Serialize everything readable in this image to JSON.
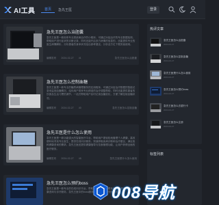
{
  "header": {
    "logo_text": "AI工具",
    "nav": [
      "首页",
      "急先王医"
    ],
    "login": "登录"
  },
  "posts": [
    {
      "title": "急先王医怎么治胆囊",
      "desc": "急先王医是一款用来专业类疾病治疗的小程序，可通过对症治疗的专业数据检测，帮助用户进行症状的诊断记录，同时还能开启多方病情的信息的，还能提供专业的医生病情解析，分析患者的身体状况给出参考建议，分析全方位下载安装使用。",
      "author": "编辑发布",
      "date": "2024-02-27",
      "views": "41",
      "category": "急先王医怎么治胆囊"
    },
    {
      "title": "急先王医怎么控制血糖",
      "desc": "急先王医是一款专业的糖尿病管理服务的应用程序，可通过对症治疗数据的智能记录来监测血糖情况，给你用户带来专业精准的治疗调整帮助，同时还能提供患者的饮食及生活习惯的调节，一站式帮助用户实时记录血糖变化，方便了解控制血糖状况。",
      "author": "编辑发布",
      "date": "2024-02-27",
      "views": "40",
      "category": "急先王医怎么控制血糖"
    },
    {
      "title": "急先王医是什么怎么使用",
      "desc": "急先王医是一款功能强大的智能医疗平台，帮助用户更轻松地管理个人健康，高效便利地寻找专业医生，提供在线问诊服务，快速获取疾病诊断和治疗建议，满足各种健康咨询的需求，急先王医还提供健康指导与饮食管理功能，让用户获得全面的医疗服务。",
      "author": "编辑发布",
      "date": "2024-02-27",
      "views": "45",
      "category": "急先王医是什么怎么使用"
    },
    {
      "title": "急先王医怎么预约boss",
      "desc": "急先王医是一款专业的在线问诊平台，帮助用户随时随地联系医生，获得权威的健康咨询与诊疗服务，急先王医中的boss服务可以帮助用户快速预约。",
      "author": "编辑发布",
      "date": "2024-02-27",
      "views": "38",
      "category": "急先王医怎么预约boss"
    }
  ],
  "sidebar": {
    "hot_title": "热评文章",
    "hot_items": [
      {
        "title": "急先王医怎么治胆囊",
        "date": "2024-02-27"
      },
      {
        "title": "急先王医怎么控制血糖",
        "date": "2024-02-27"
      },
      {
        "title": "急先王医是什么怎么使用",
        "date": "2024-02-27"
      },
      {
        "title": "急先王医怎么预约boss",
        "date": "2024-02-27"
      },
      {
        "title": "急先王医怎么去银行卡",
        "date": "2024-02-27"
      },
      {
        "title": "急先王医怎么注册",
        "date": "2024-02-27"
      }
    ],
    "tag_title": "标签列表"
  },
  "watermark": "008导航",
  "colors": {
    "accent": "#4d8df7",
    "bg": "#1d2026",
    "card": "#23272e"
  }
}
